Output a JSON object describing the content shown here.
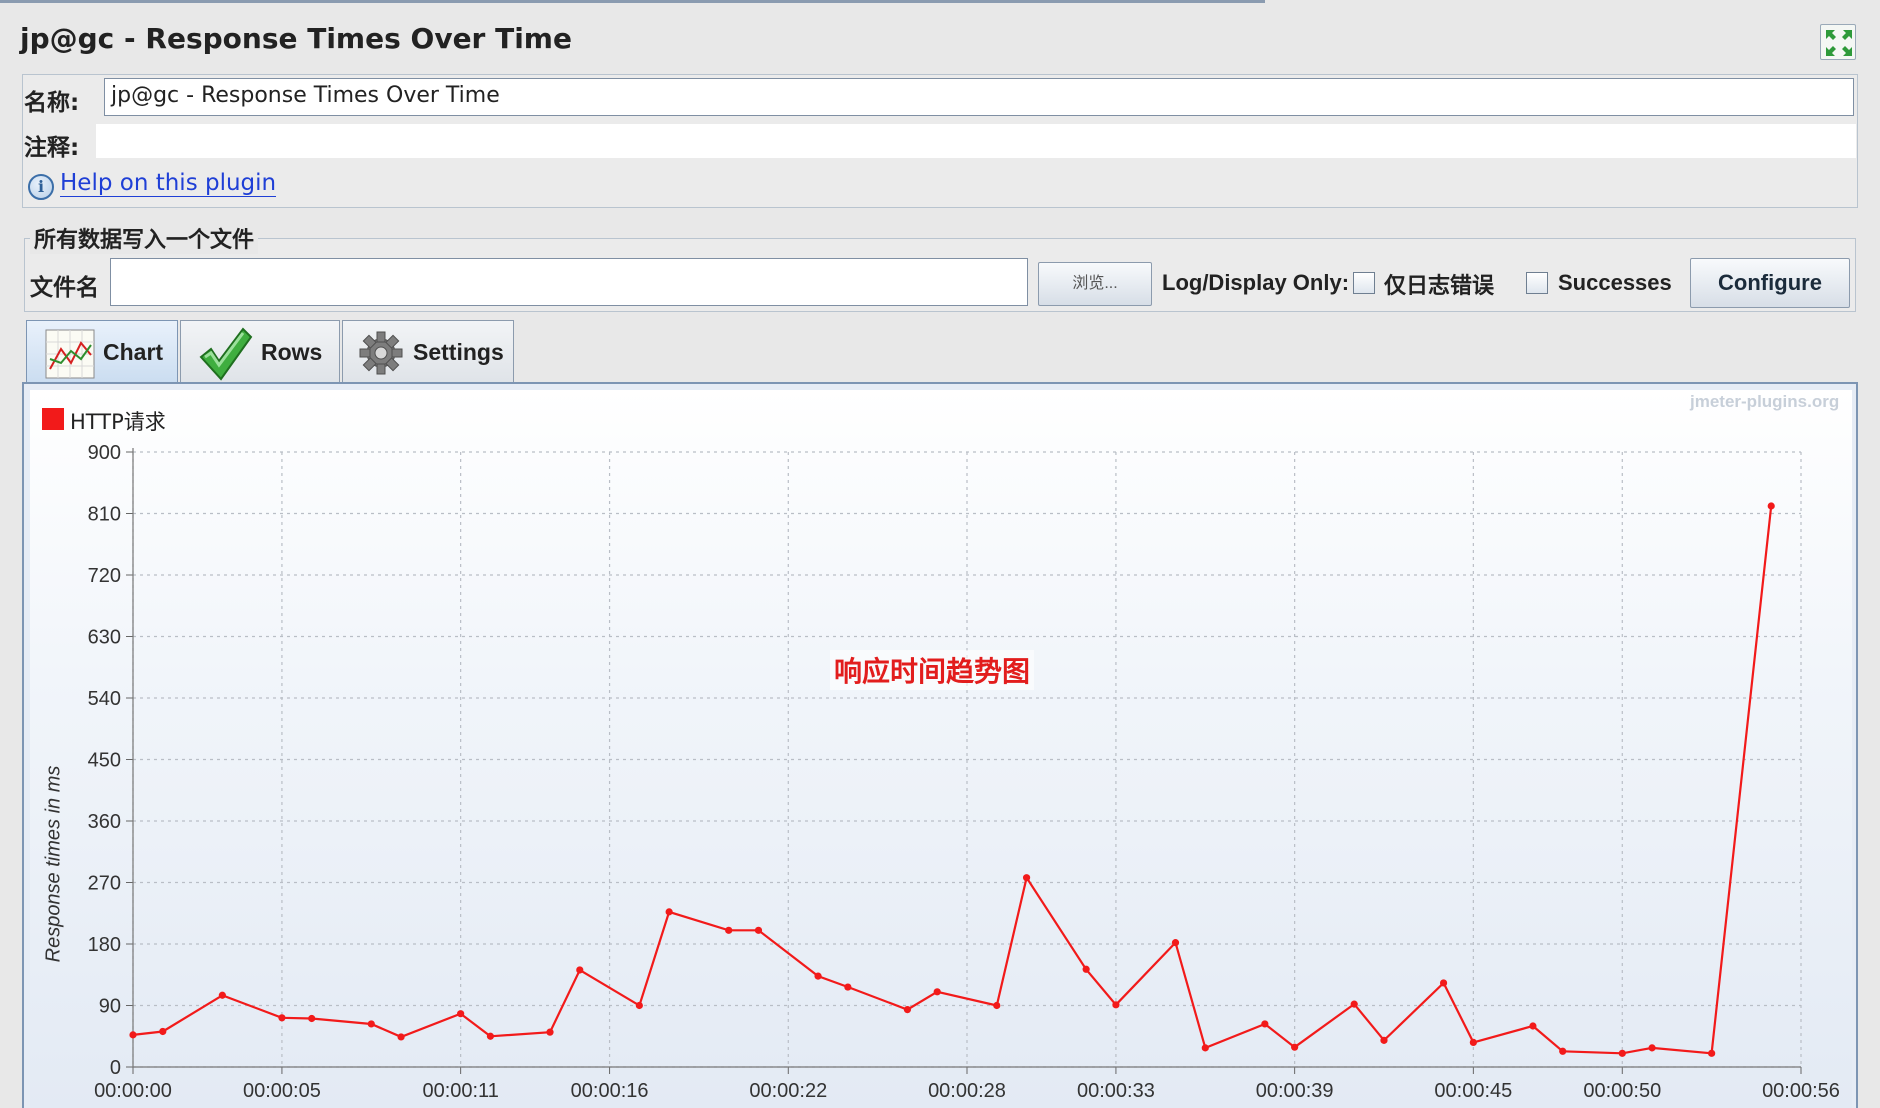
{
  "window": {
    "title": "jp@gc - Response Times Over Time"
  },
  "name_panel": {
    "name_label": "名称:",
    "name_value": "jp@gc - Response Times Over Time",
    "comment_label": "注释:",
    "comment_value": "",
    "help_link": "Help on this plugin"
  },
  "file_panel": {
    "legend": "所有数据写入一个文件",
    "filename_label": "文件名",
    "filename_value": "",
    "browse_label": "浏览...",
    "log_display_label": "Log/Display Only:",
    "errors_only_label": "仅日志错误",
    "errors_only_checked": false,
    "successes_label": "Successes",
    "successes_checked": false,
    "configure_label": "Configure"
  },
  "tabs": [
    {
      "label": "Chart",
      "icon": "line-chart-icon",
      "active": true
    },
    {
      "label": "Rows",
      "icon": "checkmark-icon",
      "active": false
    },
    {
      "label": "Settings",
      "icon": "gear-icon",
      "active": false
    }
  ],
  "chart": {
    "watermark": "jmeter-plugins.org",
    "annotation": "响应时间趋势图",
    "annotation_color": "#e21d1d"
  },
  "chart_data": {
    "type": "line",
    "title": "",
    "xlabel": "",
    "ylabel": "Response times in ms",
    "ylim": [
      0,
      900
    ],
    "yticks": [
      0,
      90,
      180,
      270,
      360,
      450,
      540,
      630,
      720,
      810,
      900
    ],
    "xlim": [
      "00:00:00",
      "00:00:56"
    ],
    "xticks": [
      "00:00:00",
      "00:00:05",
      "00:00:11",
      "00:00:16",
      "00:00:22",
      "00:00:28",
      "00:00:33",
      "00:00:39",
      "00:00:45",
      "00:00:50",
      "00:00:56"
    ],
    "grid": true,
    "legend_position": "top-left",
    "series": [
      {
        "name": "HTTP请求",
        "color": "#f21a1a",
        "x": [
          "00:00:00",
          "00:00:01",
          "00:00:03",
          "00:00:05",
          "00:00:06",
          "00:00:08",
          "00:00:09",
          "00:00:11",
          "00:00:12",
          "00:00:14",
          "00:00:15",
          "00:00:17",
          "00:00:18",
          "00:00:20",
          "00:00:21",
          "00:00:23",
          "00:00:24",
          "00:00:26",
          "00:00:27",
          "00:00:29",
          "00:00:30",
          "00:00:32",
          "00:00:33",
          "00:00:35",
          "00:00:36",
          "00:00:38",
          "00:00:39",
          "00:00:41",
          "00:00:42",
          "00:00:44",
          "00:00:45",
          "00:00:47",
          "00:00:48",
          "00:00:50",
          "00:00:51",
          "00:00:53",
          "00:00:55"
        ],
        "y": [
          47,
          52,
          105,
          72,
          71,
          63,
          44,
          78,
          45,
          51,
          142,
          90,
          227,
          200,
          200,
          133,
          117,
          84,
          110,
          90,
          277,
          143,
          91,
          182,
          28,
          63,
          29,
          92,
          39,
          123,
          36,
          60,
          23,
          20,
          28,
          20,
          821
        ]
      }
    ]
  }
}
